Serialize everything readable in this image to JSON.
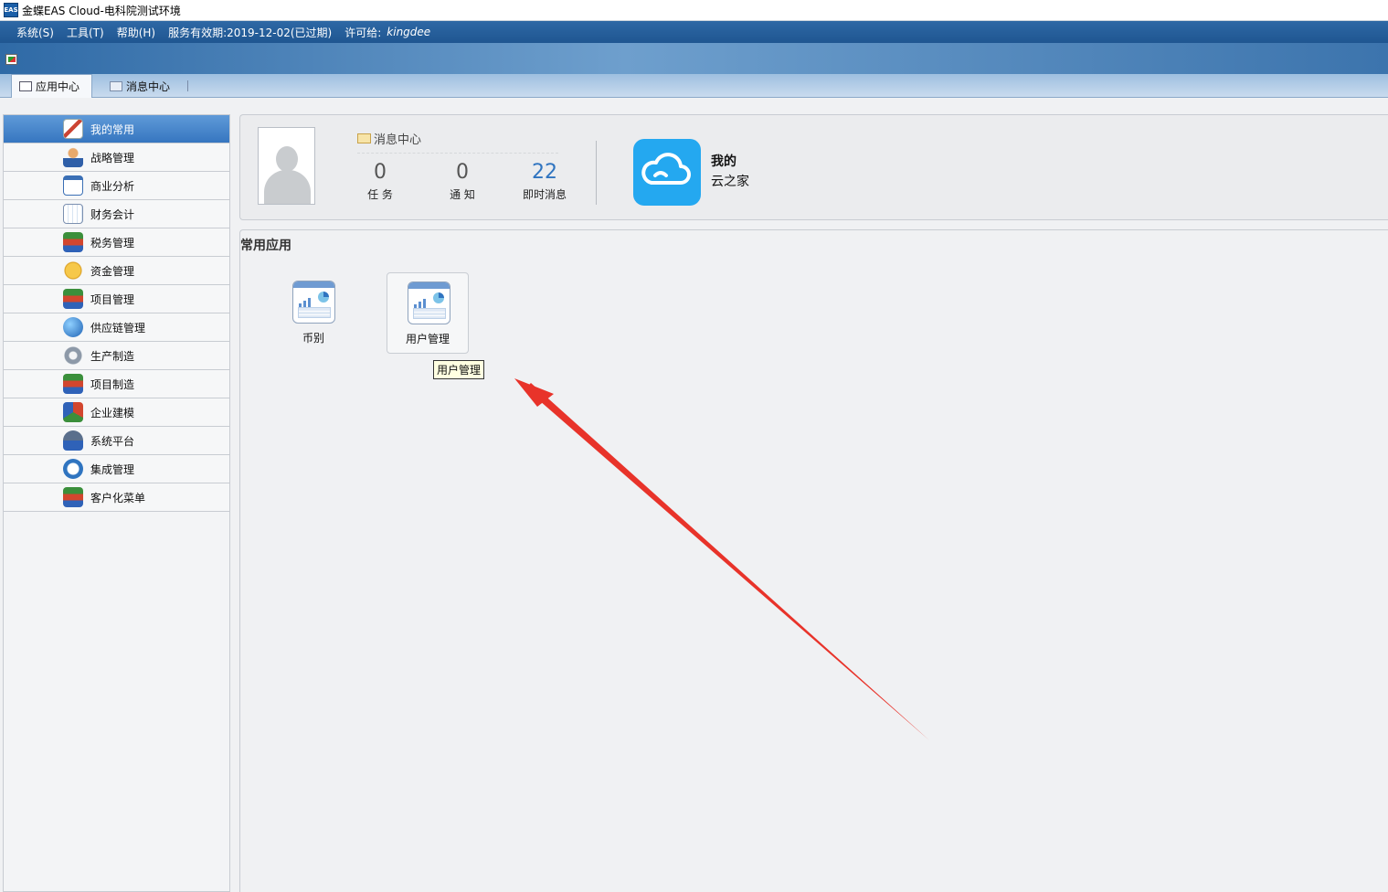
{
  "window": {
    "logo_text": "EAS",
    "title": "金蝶EAS Cloud-电科院测试环境"
  },
  "menubar": {
    "items": [
      "系统(S)",
      "工具(T)",
      "帮助(H)"
    ],
    "service_validity": "服务有效期:2019-12-02(已过期)",
    "license_label": "许可给:",
    "license_value": "kingdee"
  },
  "tabs": [
    {
      "label": "应用中心",
      "active": true
    },
    {
      "label": "消息中心",
      "active": false
    }
  ],
  "sidebar": {
    "items": [
      {
        "label": "我的常用",
        "icon": "pen-paper-icon",
        "selected": true
      },
      {
        "label": "战略管理",
        "icon": "person-icon"
      },
      {
        "label": "商业分析",
        "icon": "chart-icon"
      },
      {
        "label": "财务会计",
        "icon": "ledger-icon"
      },
      {
        "label": "税务管理",
        "icon": "books-icon"
      },
      {
        "label": "资金管理",
        "icon": "coins-icon"
      },
      {
        "label": "项目管理",
        "icon": "books-icon"
      },
      {
        "label": "供应链管理",
        "icon": "globe-icon"
      },
      {
        "label": "生产制造",
        "icon": "gears-icon"
      },
      {
        "label": "项目制造",
        "icon": "books-icon"
      },
      {
        "label": "企业建模",
        "icon": "cubes-icon"
      },
      {
        "label": "系统平台",
        "icon": "platform-icon"
      },
      {
        "label": "集成管理",
        "icon": "eas-icon"
      },
      {
        "label": "客户化菜单",
        "icon": "books-icon"
      }
    ]
  },
  "user_panel": {
    "message_center": "消息中心",
    "counters": [
      {
        "value": "0",
        "label": "任 务"
      },
      {
        "value": "0",
        "label": "通 知"
      },
      {
        "value": "22",
        "label": "即时消息"
      }
    ],
    "cloud_line1": "我的",
    "cloud_line2": "云之家"
  },
  "common_apps": {
    "title": "常用应用",
    "apps": [
      {
        "label": "币别"
      },
      {
        "label": "用户管理"
      }
    ],
    "tooltip": "用户管理"
  },
  "colors": {
    "accent_blue": "#24a8f0",
    "menubar": "#1f5691",
    "annotation_arrow": "#e8332a"
  }
}
